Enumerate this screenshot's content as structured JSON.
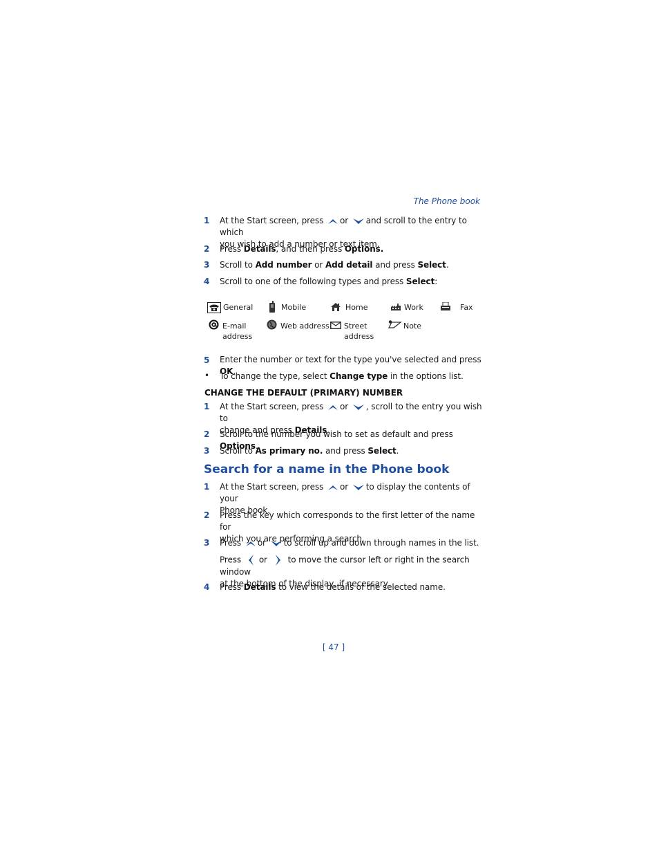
{
  "header": {
    "section_title": "The Phone book"
  },
  "add_steps": [
    {
      "num": "1",
      "parts": [
        "At the Start screen, press",
        "or",
        "and scroll to the entry to which",
        "you wish to add a number or text item."
      ]
    },
    {
      "num": "2",
      "pre": "Press ",
      "b1": "Details",
      "mid": ", and then press ",
      "b2": "Options."
    },
    {
      "num": "3",
      "pre": "Scroll to ",
      "b1": "Add number",
      "mid": " or ",
      "b2": "Add detail",
      "mid2": " and press ",
      "b3": "Select",
      "post": "."
    },
    {
      "num": "4",
      "pre": "Scroll to one of the following types and press ",
      "b1": "Select",
      "post": ":"
    }
  ],
  "types": [
    {
      "label": "General",
      "icon": "phone-icon"
    },
    {
      "label": "Mobile",
      "icon": "mobile-icon"
    },
    {
      "label": "Home",
      "icon": "home-icon"
    },
    {
      "label": "Work",
      "icon": "work-icon"
    },
    {
      "label": "Fax",
      "icon": "fax-icon"
    },
    {
      "label": "E-mail",
      "label2": "address",
      "icon": "email-icon"
    },
    {
      "label": "Web address",
      "icon": "web-icon"
    },
    {
      "label": "Street",
      "label2": "address",
      "icon": "envelope-icon"
    },
    {
      "label": "Note",
      "icon": "note-icon"
    }
  ],
  "step5": {
    "num": "5",
    "pre": "Enter the number or text for the type you've selected and press ",
    "b1": "OK",
    "post": "."
  },
  "bullet": {
    "mark": "•",
    "pre": "To change the type, select ",
    "b1": "Change type",
    "post": " in the options list."
  },
  "default_section": {
    "title": "CHANGE THE DEFAULT (PRIMARY) NUMBER",
    "steps": [
      {
        "num": "1",
        "parts": [
          "At the Start screen, press",
          "or",
          ", scroll to the entry you wish to",
          "change and press "
        ],
        "b1": "Details",
        "post": "."
      },
      {
        "num": "2",
        "pre": "Scroll to the number you wish to set as default and press ",
        "b1": "Options",
        "post": "."
      },
      {
        "num": "3",
        "pre": "Scroll to ",
        "b1": "As primary no.",
        "mid": " and press ",
        "b2": "Select",
        "post": "."
      }
    ]
  },
  "search_section": {
    "title": "Search for a name in the Phone book",
    "steps": [
      {
        "num": "1",
        "parts": [
          "At the Start screen, press",
          "or",
          "to display the contents of your",
          "Phone book."
        ]
      },
      {
        "num": "2",
        "line1": "Press the key which corresponds to the first letter of the name for",
        "line2": "which you are performing a search."
      },
      {
        "num": "3",
        "parts": [
          "Press",
          "or",
          "to scroll up and down through names in the list."
        ]
      },
      {
        "num": "",
        "parts": [
          "Press",
          "or",
          "to move the cursor left or right in the search window",
          "at the bottom of the display, if necessary."
        ]
      },
      {
        "num": "4",
        "pre": "Press ",
        "b1": "Details",
        "post": " to view the details of the selected name."
      }
    ]
  },
  "footer": {
    "page_number": "[ 47 ]"
  },
  "colors": {
    "accent": "#1f4e9c",
    "text": "#1a1a1a"
  }
}
